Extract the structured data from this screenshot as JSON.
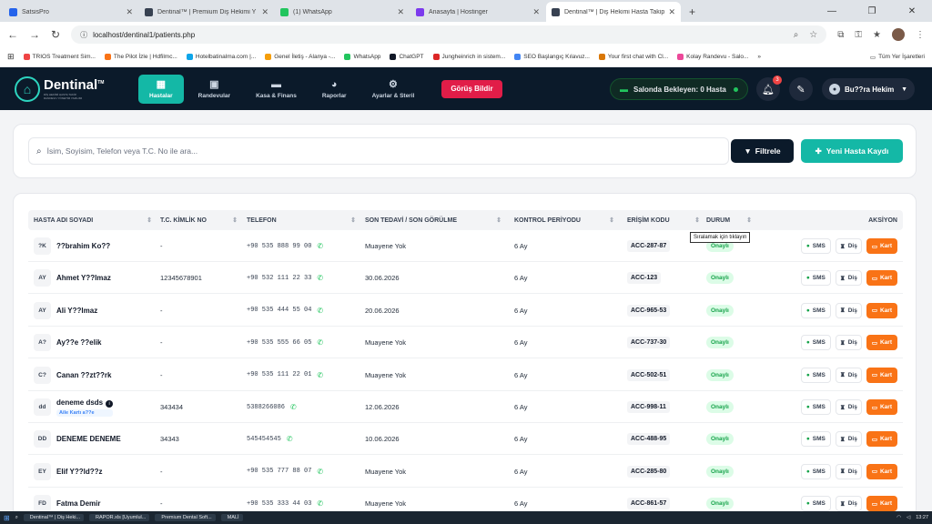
{
  "browser": {
    "tabs": [
      {
        "title": "SatsisPro",
        "color": "#2563eb",
        "active": false
      },
      {
        "title": "Dentinal™ | Premium Diş Hekimi Y",
        "color": "#374151",
        "active": false
      },
      {
        "title": "(1) WhatsApp",
        "color": "#22c55e",
        "active": false
      },
      {
        "title": "Anasayfa | Hostinger",
        "color": "#7c3aed",
        "active": false
      },
      {
        "title": "Dentinal™ | Diş Hekimi Hasta Takip",
        "color": "#374151",
        "active": true
      }
    ],
    "url": "localhost/dentinal1/patients.php",
    "bookmarks": [
      {
        "label": "TRIOS Treatment Sim...",
        "color": "#ef4444"
      },
      {
        "label": "The Pilot İzle | Hdfilmc...",
        "color": "#f97316"
      },
      {
        "label": "Hotelbatinalma.com |...",
        "color": "#0ea5e9"
      },
      {
        "label": "Genel İletiş - Alanya -...",
        "color": "#f59e0b"
      },
      {
        "label": "WhatsApp",
        "color": "#22c55e"
      },
      {
        "label": "ChatGPT",
        "color": "#111827"
      },
      {
        "label": "Jungheinrich in sistem...",
        "color": "#dc2626"
      },
      {
        "label": "SEO Başlangıç Kılavuz...",
        "color": "#4285f4"
      },
      {
        "label": "Your first chat with Cl...",
        "color": "#d97706"
      },
      {
        "label": "Kolay Randevu - Salo...",
        "color": "#ec4899"
      }
    ],
    "bookmarks_right": "Tüm Yer İşaretleri"
  },
  "app": {
    "logo": {
      "name": "Dentinal",
      "tm": "TM",
      "sub1": "DİŞ HEKİMİ HASTA TAKİP,",
      "sub2": "RANDEVU YÖNETİM YAZILIMI"
    },
    "nav": [
      {
        "label": "Hastalar",
        "icon": "patients-icon",
        "glyph": "▦",
        "active": true
      },
      {
        "label": "Randevular",
        "icon": "calendar-icon",
        "glyph": "▣",
        "active": false
      },
      {
        "label": "Kasa & Finans",
        "icon": "wallet-icon",
        "glyph": "▬",
        "active": false
      },
      {
        "label": "Raporlar",
        "icon": "pie-chart-icon",
        "glyph": "◕",
        "active": false
      },
      {
        "label": "Ayarlar & Steril",
        "icon": "gears-icon",
        "glyph": "⚙",
        "active": false
      }
    ],
    "gorus": "Görüş Bildir",
    "salonda": "Salonda Bekleyen: 0 Hasta",
    "notif_count": "3",
    "user": "Bu??ra Hekim"
  },
  "search": {
    "placeholder": "İsim, Soyisim, Telefon veya T.C. No ile ara...",
    "filter_label": "Filtrele",
    "new_label": "Yeni Hasta Kaydı"
  },
  "table": {
    "headers": [
      "HASTA ADI SOYADI",
      "T.C. KİMLİK NO",
      "TELEFON",
      "SON TEDAVİ / SON GÖRÜLME",
      "KONTROL PERİYODU",
      "ERİŞİM KODU",
      "DURUM",
      "AKSİYON"
    ],
    "sms_label": "SMS",
    "dis_label": "Diş",
    "kart_label": "Kart",
    "rows": [
      {
        "ini": "?K",
        "name": "??brahim Ko??",
        "tc": "-",
        "phone": "+90 535 888 99 00",
        "last": "Muayene Yok",
        "period": "6 Ay",
        "code": "ACC-287-87",
        "status": "Onaylı",
        "aile": ""
      },
      {
        "ini": "AY",
        "name": "Ahmet Y??lmaz",
        "tc": "12345678901",
        "phone": "+90 532 111 22 33",
        "last": "30.06.2026",
        "period": "6 Ay",
        "code": "ACC-123",
        "status": "Onaylı",
        "aile": ""
      },
      {
        "ini": "AY",
        "name": "Ali Y??lmaz",
        "tc": "-",
        "phone": "+90 535 444 55 04",
        "last": "20.06.2026",
        "period": "6 Ay",
        "code": "ACC-965-53",
        "status": "Onaylı",
        "aile": ""
      },
      {
        "ini": "A?",
        "name": "Ay??e ??elik",
        "tc": "-",
        "phone": "+90 535 555 66 05",
        "last": "Muayene Yok",
        "period": "6 Ay",
        "code": "ACC-737-30",
        "status": "Onaylı",
        "aile": ""
      },
      {
        "ini": "C?",
        "name": "Canan ??zt??rk",
        "tc": "-",
        "phone": "+90 535 111 22 01",
        "last": "Muayene Yok",
        "period": "6 Ay",
        "code": "ACC-502-51",
        "status": "Onaylı",
        "aile": ""
      },
      {
        "ini": "dd",
        "name": "deneme dsds",
        "tc": "343434",
        "phone": "5388266086",
        "last": "12.06.2026",
        "period": "6 Ay",
        "code": "ACC-998-11",
        "status": "Onaylı",
        "aile": "Aile Kartı a??e"
      },
      {
        "ini": "DD",
        "name": "DENEME DENEME",
        "tc": "34343",
        "phone": "545454545",
        "last": "10.06.2026",
        "period": "6 Ay",
        "code": "ACC-488-95",
        "status": "Onaylı",
        "aile": ""
      },
      {
        "ini": "EY",
        "name": "Elif Y??ld??z",
        "tc": "-",
        "phone": "+90 535 777 88 07",
        "last": "Muayene Yok",
        "period": "6 Ay",
        "code": "ACC-285-80",
        "status": "Onaylı",
        "aile": ""
      },
      {
        "ini": "FD",
        "name": "Fatma Demir",
        "tc": "-",
        "phone": "+90 535 333 44 03",
        "last": "Muayene Yok",
        "period": "6 Ay",
        "code": "ACC-861-57",
        "status": "Onaylı",
        "aile": ""
      }
    ]
  },
  "tooltip": "Sıralamak için tıklayın",
  "taskbar": {
    "apps": [
      {
        "label": "Dentinal™ | Diş Heki...",
        "color": "#3b82f6"
      },
      {
        "label": "RAPOR.xls [Uyumlul...",
        "color": "#16a34a"
      },
      {
        "label": "Premium Dental Soft...",
        "color": "#e5e7eb"
      },
      {
        "label": "MALİ",
        "color": "#facc15"
      }
    ],
    "time": "13:27"
  }
}
